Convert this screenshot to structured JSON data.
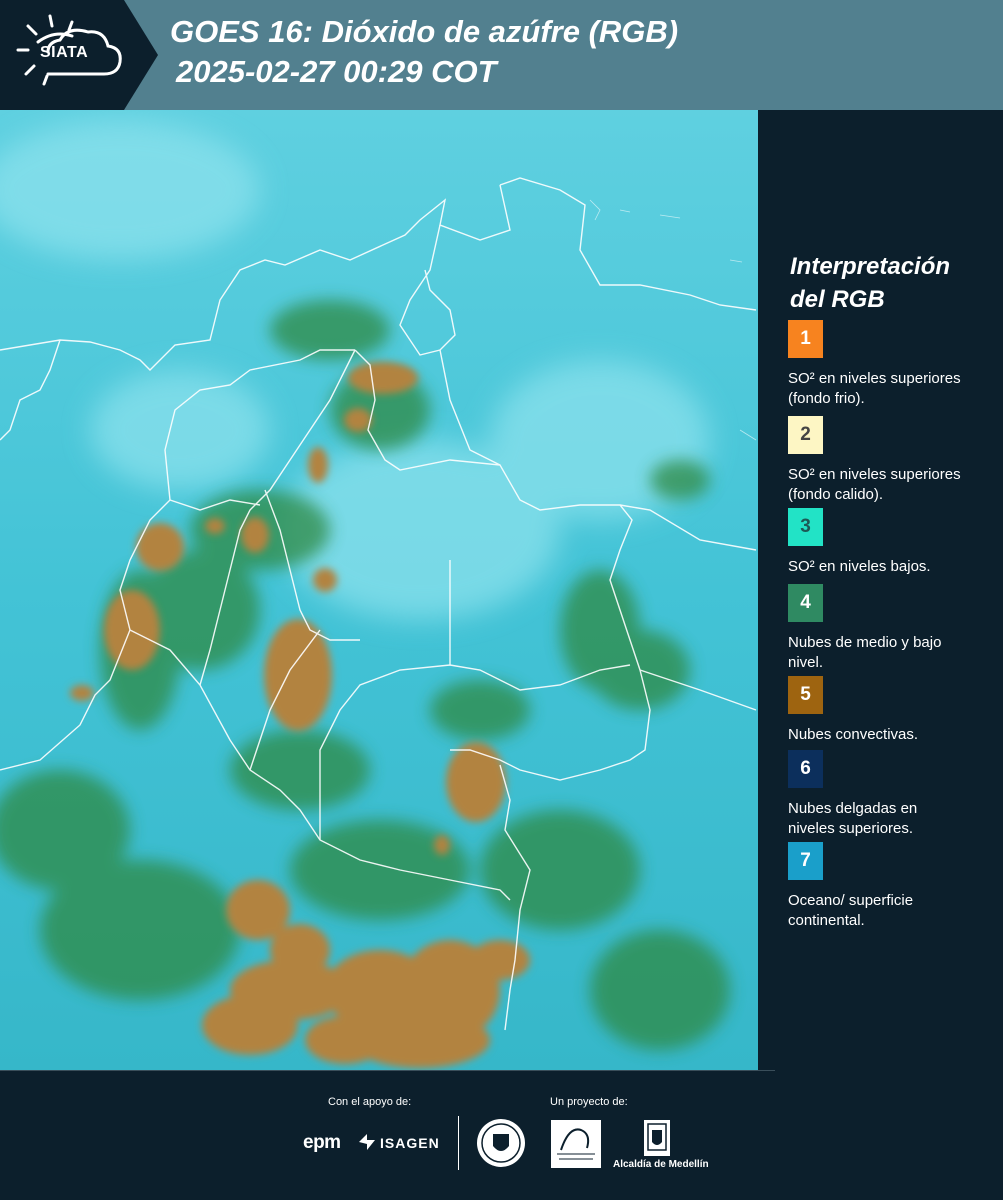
{
  "header": {
    "logo_text": "SIATA",
    "title_line1": "GOES 16: Dióxido de azúfre (RGB)",
    "title_line2": "2025-02-27 00:29 COT"
  },
  "legend": {
    "title": "Interpretación del RGB",
    "items": [
      {
        "number": "1",
        "label": "SO² en niveles superiores (fondo frio).",
        "color": "#f7831f"
      },
      {
        "number": "2",
        "label": "SO² en niveles superiores (fondo calido).",
        "color": "#fdf6c4"
      },
      {
        "number": "3",
        "label": "SO² en niveles bajos.",
        "color": "#22e3c6"
      },
      {
        "number": "4",
        "label": "Nubes de medio y bajo nivel.",
        "color": "#2f8a62"
      },
      {
        "number": "5",
        "label": "Nubes convectivas.",
        "color": "#9e6410"
      },
      {
        "number": "6",
        "label": "Nubes delgadas en niveles superiores.",
        "color": "#0c2f5c"
      },
      {
        "number": "7",
        "label": "Oceano/ superficie continental.",
        "color": "#1a9fca"
      }
    ]
  },
  "footer": {
    "support_label": "Con el apoyo de:",
    "project_label": "Un proyecto de:",
    "sponsors": [
      "epm",
      "ISAGEN"
    ],
    "partners": [
      "Alcaldía de Medellín"
    ]
  },
  "colors": {
    "background": "#0c1f2c",
    "header_band": "#52808f",
    "map_base": "#46c5d6",
    "cloud_convective": "#b28341",
    "cloud_low": "#2f8a45"
  }
}
